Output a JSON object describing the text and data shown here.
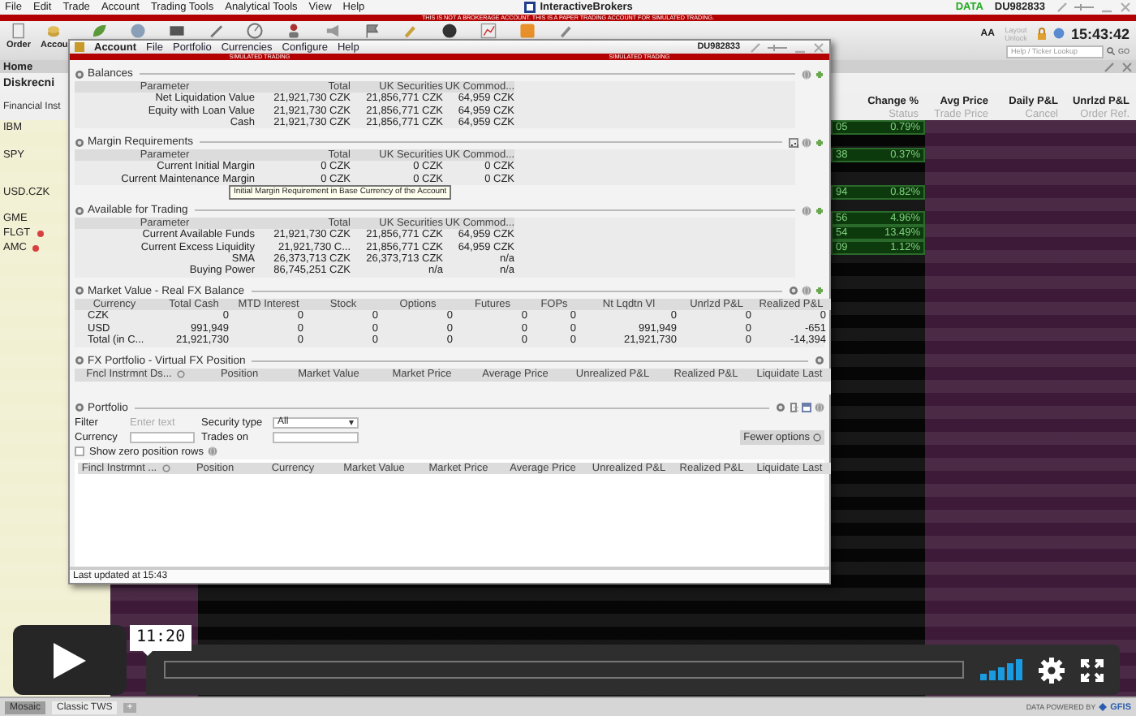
{
  "app": {
    "menu": [
      "File",
      "Edit",
      "Trade",
      "Account",
      "Trading Tools",
      "Analytical Tools",
      "View",
      "Help"
    ],
    "title": "InteractiveBrokers",
    "data_label": "DATA",
    "account_id": "DU982833",
    "warning": "THIS IS NOT A BROKERAGE ACCOUNT. THIS IS A PAPER TRADING ACCOUNT FOR SIMULATED TRADING."
  },
  "toolbar": {
    "buttons": [
      "Order",
      "Accou"
    ],
    "font_size": "AA",
    "layout": "Layout Unlock",
    "clock": "15:43:42",
    "lookup_placeholder": "Help / Ticker Lookup",
    "go": "GO"
  },
  "home_tab": "Home",
  "watchlist": {
    "title": "Diskrecni",
    "first_column": "Financial Inst",
    "columns": [
      {
        "title": "Change %",
        "subtitle": "Status"
      },
      {
        "title": "Avg Price",
        "subtitle": "Trade Price"
      },
      {
        "title": "Daily P&L",
        "subtitle": "Cancel"
      },
      {
        "title": "Unrlzd P&L",
        "subtitle": "Order Ref."
      }
    ],
    "rows": [
      {
        "symbol": "IBM",
        "alert": false,
        "column_1": "05",
        "change": "0.79%"
      },
      {
        "symbol": "SPY",
        "alert": false,
        "column_1": "38",
        "change": "0.37%"
      },
      {
        "symbol": "USD.CZK",
        "alert": false,
        "column_1": "94",
        "change": "0.82%"
      },
      {
        "symbol": "GME",
        "alert": false,
        "column_1": "56",
        "change": "4.96%"
      },
      {
        "symbol": "FLGT",
        "alert": true,
        "column_1": "54",
        "change": "13.49%"
      },
      {
        "symbol": "AMC",
        "alert": true,
        "column_1": "09",
        "change": "1.12%"
      }
    ]
  },
  "account_window": {
    "menu": [
      "Account",
      "File",
      "Portfolio",
      "Currencies",
      "Configure",
      "Help"
    ],
    "account_id": "DU982833",
    "banners": [
      "SIMULATED TRADING",
      "SIMULATED TRADING"
    ],
    "sections": [
      {
        "kind": "parameters",
        "title": "Balances",
        "columns": [
          "Parameter",
          "Total",
          "UK Securities",
          "UK Commod..."
        ],
        "rows": [
          [
            "Net Liquidation Value",
            "21,921,730 CZK",
            "21,856,771 CZK",
            "64,959 CZK"
          ],
          [
            "Equity with Loan Value",
            "21,921,730 CZK",
            "21,856,771 CZK",
            "64,959 CZK"
          ],
          [
            "Cash",
            "21,921,730 CZK",
            "21,856,771 CZK",
            "64,959 CZK"
          ]
        ]
      },
      {
        "kind": "parameters",
        "title": "Margin Requirements",
        "columns": [
          "Parameter",
          "Total",
          "UK Securities",
          "UK Commod..."
        ],
        "rows": [
          [
            "Current Initial Margin",
            "0 CZK",
            "0 CZK",
            "0 CZK"
          ],
          [
            "Current Maintenance Margin",
            "0 CZK",
            "0 CZK",
            "0 CZK"
          ]
        ]
      },
      {
        "kind": "parameters",
        "title": "Available for Trading",
        "columns": [
          "Parameter",
          "Total",
          "UK Securities",
          "UK Commod..."
        ],
        "rows": [
          [
            "Current Available Funds",
            "21,921,730 CZK",
            "21,856,771 CZK",
            "64,959 CZK"
          ],
          [
            "Current Excess Liquidity",
            "21,921,730 C...",
            "21,856,771 CZK",
            "64,959 CZK"
          ],
          [
            "SMA",
            "26,373,713 CZK",
            "26,373,713 CZK",
            "n/a"
          ],
          [
            "Buying Power",
            "86,745,251 CZK",
            "n/a",
            "n/a"
          ]
        ]
      },
      {
        "kind": "grid",
        "title": "Market Value - Real FX Balance",
        "sorted": false,
        "columns": [
          "Currency",
          "Total Cash",
          "MTD Interest",
          "Stock",
          "Options",
          "Futures",
          "FOPs",
          "Nt Lqdtn Vl",
          "Unrlzd P&L",
          "Realized P&L"
        ],
        "rows": [
          [
            "CZK",
            "0",
            "0",
            "0",
            "0",
            "0",
            "0",
            "0",
            "0",
            "0"
          ],
          [
            "USD",
            "991,949",
            "0",
            "0",
            "0",
            "0",
            "0",
            "991,949",
            "0",
            "-651"
          ],
          [
            "Total (in C...",
            "21,921,730",
            "0",
            "0",
            "0",
            "0",
            "0",
            "21,921,730",
            "0",
            "-14,394"
          ]
        ]
      },
      {
        "kind": "grid",
        "title": "FX Portfolio - Virtual FX Position",
        "sorted": true,
        "columns": [
          "Fncl Instrmnt Ds...",
          "Position",
          "Market Value",
          "Market Price",
          "Average Price",
          "Unrealized P&L",
          "Realized P&L",
          "Liquidate Last"
        ]
      },
      {
        "kind": "portfolio",
        "title": "Portfolio",
        "filter": {
          "label": "Filter",
          "placeholder": "Enter text"
        },
        "security_type": {
          "label": "Security type",
          "value": "All"
        },
        "currency": {
          "label": "Currency"
        },
        "trades_on": {
          "label": "Trades on"
        },
        "show_zero": {
          "label": "Show zero position rows",
          "checked": false
        },
        "fewer_options": "Fewer options",
        "sorted": true,
        "columns": [
          "Fincl Instrmnt ...",
          "Position",
          "Currency",
          "Market Value",
          "Market Price",
          "Average Price",
          "Unrealized P&L",
          "Realized P&L",
          "Liquidate Last"
        ]
      }
    ],
    "tooltip": "Initial Margin Requirement in Base Currency of the Account",
    "status": "Last updated at 15:43"
  },
  "bottom_tabs": [
    {
      "label": "Mosaic",
      "selected": true
    },
    {
      "label": "Classic TWS",
      "selected": false
    }
  ],
  "add_tab": "+",
  "credit": {
    "text": "DATA POWERED BY",
    "brand": "GFIS"
  },
  "player": {
    "time": "11:20"
  }
}
